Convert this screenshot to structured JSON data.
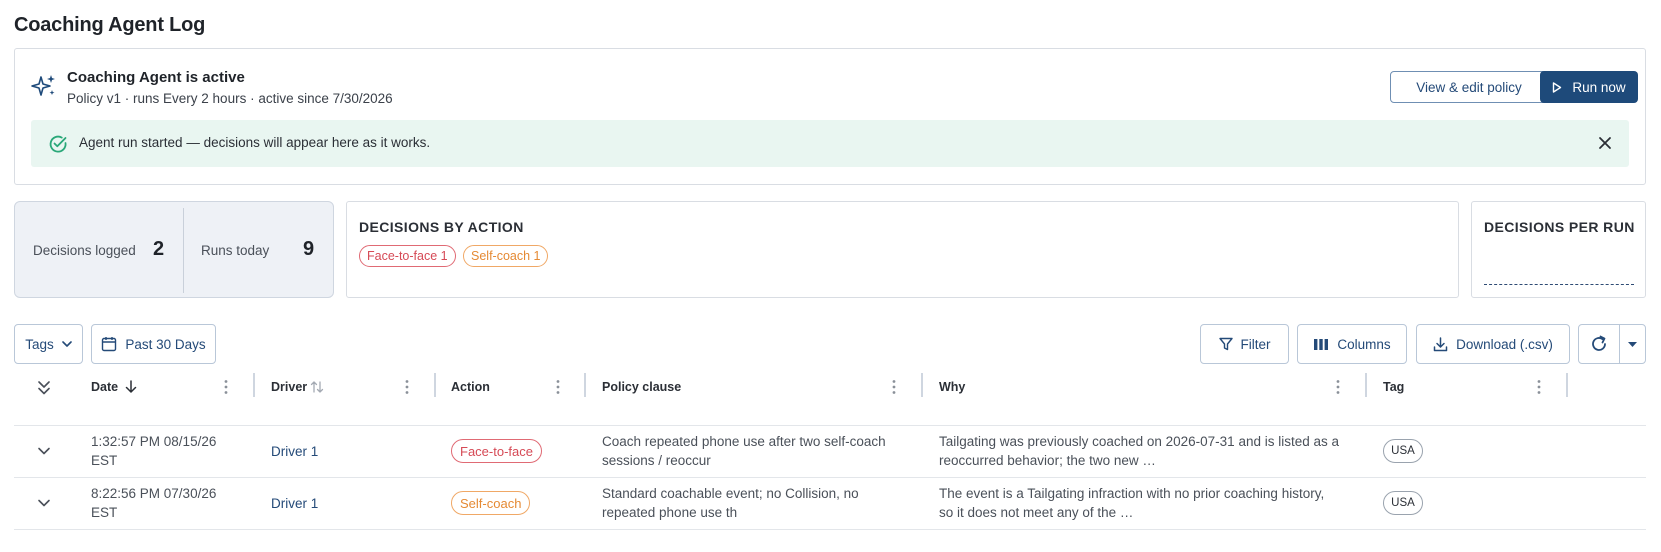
{
  "page_title": "Coaching Agent Log",
  "agent": {
    "title": "Coaching Agent is active",
    "subtitle": "Policy v1 · runs Every 2 hours · active since 7/30/2026",
    "edit_label": "View & edit policy",
    "run_label": "Run now",
    "banner_text": "Agent run started — decisions will appear here as it works.",
    "colors": {
      "accent": "#1e4a7a",
      "banner_bg": "#e9f6f1",
      "success": "#2aa879"
    },
    "icons": {
      "agent": "sparkle-icon",
      "success": "check-circle-icon",
      "close": "close-icon",
      "run": "play-icon"
    }
  },
  "stats": {
    "decisions_label": "Decisions logged",
    "decisions_value": "2",
    "runs_label": "Runs today",
    "runs_value": "9"
  },
  "by_action": {
    "title": "DECISIONS BY ACTION",
    "chips": [
      {
        "label": "Face-to-face 1",
        "color": "#d64a56"
      },
      {
        "label": "Self-coach 1",
        "color": "#e58a34"
      }
    ]
  },
  "per_run": {
    "title": "DECISIONS PER RUN"
  },
  "toolbar": {
    "tags_label": "Tags",
    "date_range_label": "Past 30 Days",
    "filter_label": "Filter",
    "columns_label": "Columns",
    "download_label": "Download (.csv)",
    "icons": [
      "chevron-down-icon",
      "calendar-icon",
      "filter-icon",
      "columns-icon",
      "download-icon",
      "refresh-icon",
      "caret-down-icon"
    ]
  },
  "table": {
    "headers": {
      "date": "Date",
      "driver": "Driver",
      "action": "Action",
      "policy": "Policy clause",
      "why": "Why",
      "tag": "Tag"
    },
    "rows": [
      {
        "date_line1": "1:32:57 PM 08/15/26",
        "date_line2": "EST",
        "driver": "Driver 1",
        "action": "Face-to-face",
        "action_color": "#d64a56",
        "policy_line1": "Coach repeated phone use after two self-coach",
        "policy_line2": "sessions / reoccur",
        "why_line1": "Tailgating was previously coached on 2026-07-31 and is listed as a",
        "why_line2": "reoccurred behavior; the two new …",
        "tag": "USA"
      },
      {
        "date_line1": "8:22:56 PM 07/30/26",
        "date_line2": "EST",
        "driver": "Driver 1",
        "action": "Self-coach",
        "action_color": "#e58a34",
        "policy_line1": "Standard coachable event; no Collision, no",
        "policy_line2": "repeated phone use th",
        "why_line1": "The event is a Tailgating infraction with no prior coaching history,",
        "why_line2": "so it does not meet any of the …",
        "tag": "USA"
      }
    ]
  }
}
